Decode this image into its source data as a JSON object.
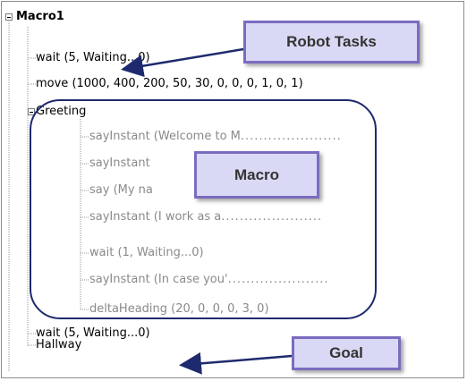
{
  "tree": {
    "root": {
      "label": "Macro1"
    },
    "nodes": [
      {
        "label": "wait (5, Waiting...0)"
      },
      {
        "label": "move (1000, 400, 200, 50, 30, 0, 0, 0, 1, 0, 1)"
      },
      {
        "label": "Greeting"
      },
      {
        "label": "sayInstant (Welcome to M",
        "trail": "......................"
      },
      {
        "label": "sayInstant",
        "trail": ""
      },
      {
        "label": "say (My na",
        "trail": ""
      },
      {
        "label": "sayInstant (I work as a",
        "trail": "......................"
      },
      {
        "label": "wait (1, Waiting...0)",
        "trail": ""
      },
      {
        "label": "sayInstant (In case you'",
        "trail": "......................"
      },
      {
        "label": "deltaHeading (20, 0, 0, 0, 3, 0)",
        "trail": ""
      },
      {
        "label": "wait (5, Waiting...0)"
      },
      {
        "label": "Hallway"
      }
    ]
  },
  "callouts": {
    "robot_tasks": "Robot Tasks",
    "macro": "Macro",
    "goal": "Goal"
  },
  "colors": {
    "callout_fill": "#d9d9f5",
    "callout_border": "#7b6cbf",
    "oval_border": "#1e2a6e",
    "arrow": "#1e2a6e",
    "muted_text": "#8a8a8a"
  }
}
